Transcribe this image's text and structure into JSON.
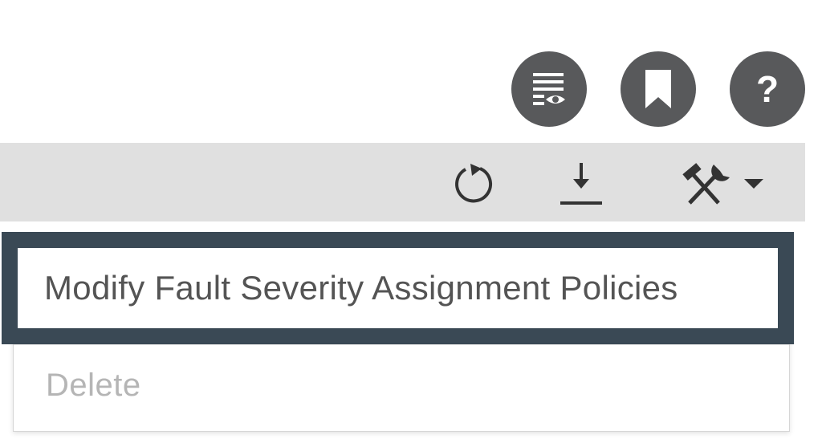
{
  "header_actions": {
    "view_icon": "list-view-icon",
    "bookmark_icon": "bookmark-icon",
    "help_icon": "help-icon",
    "help_glyph": "?"
  },
  "toolbar": {
    "refresh_icon": "refresh-icon",
    "download_icon": "download-icon",
    "tools_icon": "tools-dropdown-icon"
  },
  "menu": {
    "items": [
      {
        "label": "Modify Fault Severity Assignment Policies",
        "highlighted": true,
        "enabled": true
      },
      {
        "label": "Delete",
        "highlighted": false,
        "enabled": false
      }
    ]
  },
  "colors": {
    "icon_circle": "#58595b",
    "toolbar_bg": "#e0e0e0",
    "highlight_border": "#3a4955",
    "disabled_text": "#b5b5b5",
    "menu_text": "#545454"
  }
}
